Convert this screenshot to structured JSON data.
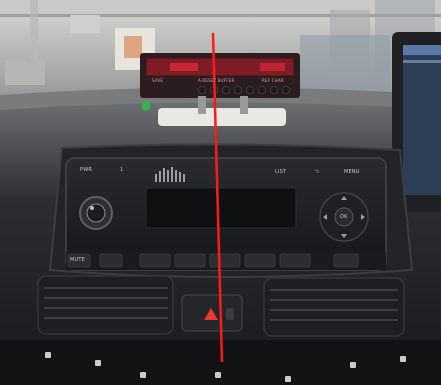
{
  "scene": {
    "description_labels": {
      "radio_top_left": "PWR",
      "radio_top_left2": "1",
      "radio_list": "LIST",
      "radio_back": "⮌",
      "radio_menu": "MENU",
      "radio_ok": "OK",
      "radio_bottom_left": "MUTE",
      "meter_left_label": "SAVE",
      "meter_mid_label": "A·RESET   BUFFER",
      "meter_right_label": "REF   CHAR"
    },
    "colors": {
      "red_line": "#ff1a1a",
      "meter_led": "#e02a3a",
      "indicator_green": "#2dbb44",
      "hazard_red": "#e53935"
    }
  }
}
